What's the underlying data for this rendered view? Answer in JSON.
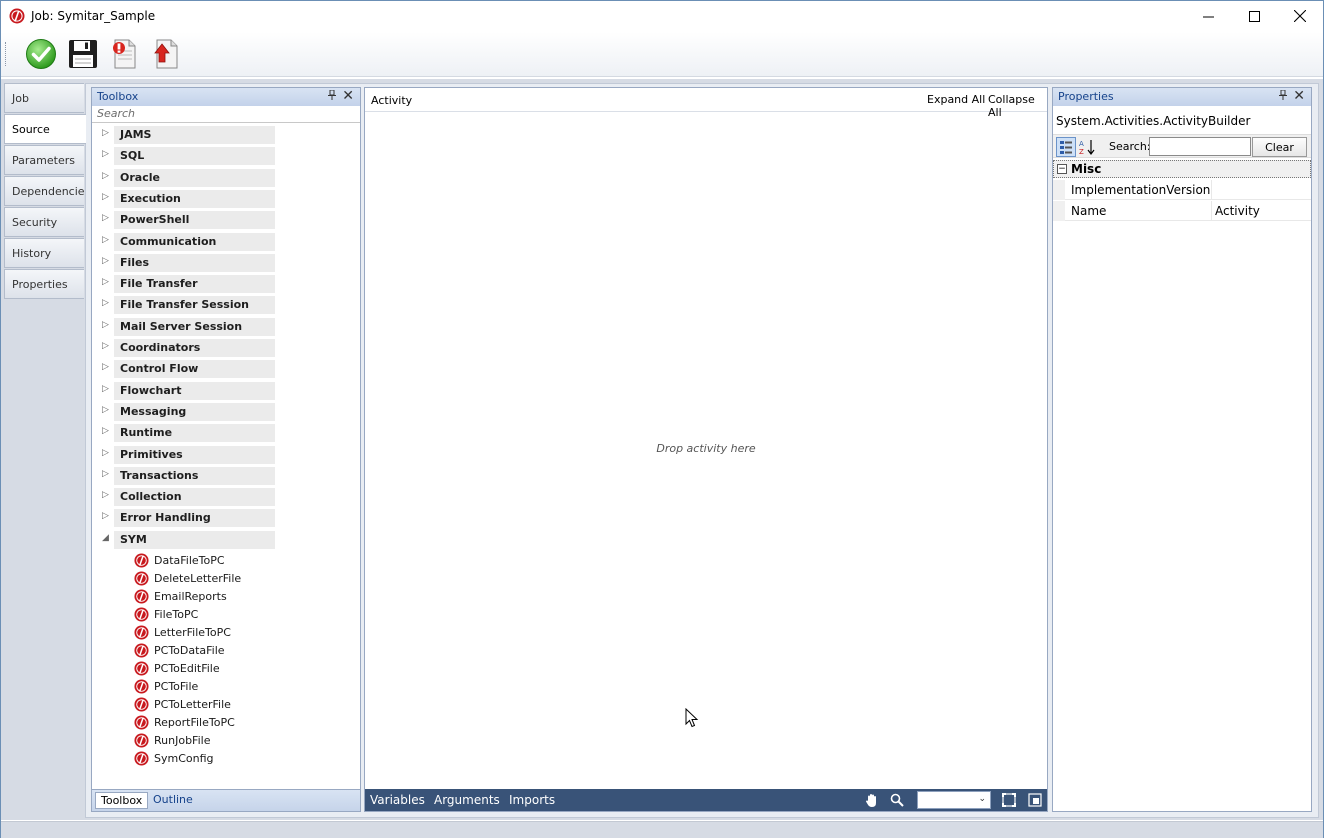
{
  "window": {
    "title": "Job: Symitar_Sample",
    "minimize": "—",
    "maximize": "☐",
    "close": "✕"
  },
  "toolbar": {
    "buttons": [
      "check-icon",
      "save-icon",
      "document-icon",
      "upload-icon"
    ]
  },
  "left_tabs": [
    "Job",
    "Source",
    "Parameters",
    "Dependencies",
    "Security",
    "History",
    "Properties"
  ],
  "left_tabs_active": "Source",
  "toolbox": {
    "title": "Toolbox",
    "search_placeholder": "Search",
    "categories": [
      "JAMS",
      "SQL",
      "Oracle",
      "Execution",
      "PowerShell",
      "Communication",
      "Files",
      "File Transfer",
      "File Transfer Session",
      "Mail Server Session",
      "Coordinators",
      "Control Flow",
      "Flowchart",
      "Messaging",
      "Runtime",
      "Primitives",
      "Transactions",
      "Collection",
      "Error Handling",
      "SYM"
    ],
    "expanded_category": "SYM",
    "sym_items": [
      "DataFileToPC",
      "DeleteLetterFile",
      "EmailReports",
      "FileToPC",
      "LetterFileToPC",
      "PCToDataFile",
      "PCToEditFile",
      "PCToFile",
      "PCToLetterFile",
      "ReportFileToPC",
      "RunJobFile",
      "SymConfig"
    ],
    "bottom_tabs": [
      "Toolbox",
      "Outline"
    ]
  },
  "designer": {
    "title": "Activity",
    "expand_all": "Expand All",
    "collapse_all": "Collapse All",
    "drop_hint": "Drop activity here",
    "footer_links": [
      "Variables",
      "Arguments",
      "Imports"
    ],
    "footer_icons": [
      "pan-hand-icon",
      "zoom-icon",
      "fit-to-screen-icon",
      "overview-icon"
    ]
  },
  "properties": {
    "title": "Properties",
    "object_name": "System.Activities.ActivityBuilder",
    "search_label": "Search:",
    "clear_label": "Clear",
    "section": "Misc",
    "section_toggle": "−",
    "rows": [
      {
        "name": "ImplementationVersion",
        "value": ""
      },
      {
        "name": "Name",
        "value": "Activity"
      }
    ]
  },
  "colors": {
    "accent_header": "#15428b",
    "designer_footer": "#395378",
    "workspace_bg": "#d6dbe4"
  }
}
